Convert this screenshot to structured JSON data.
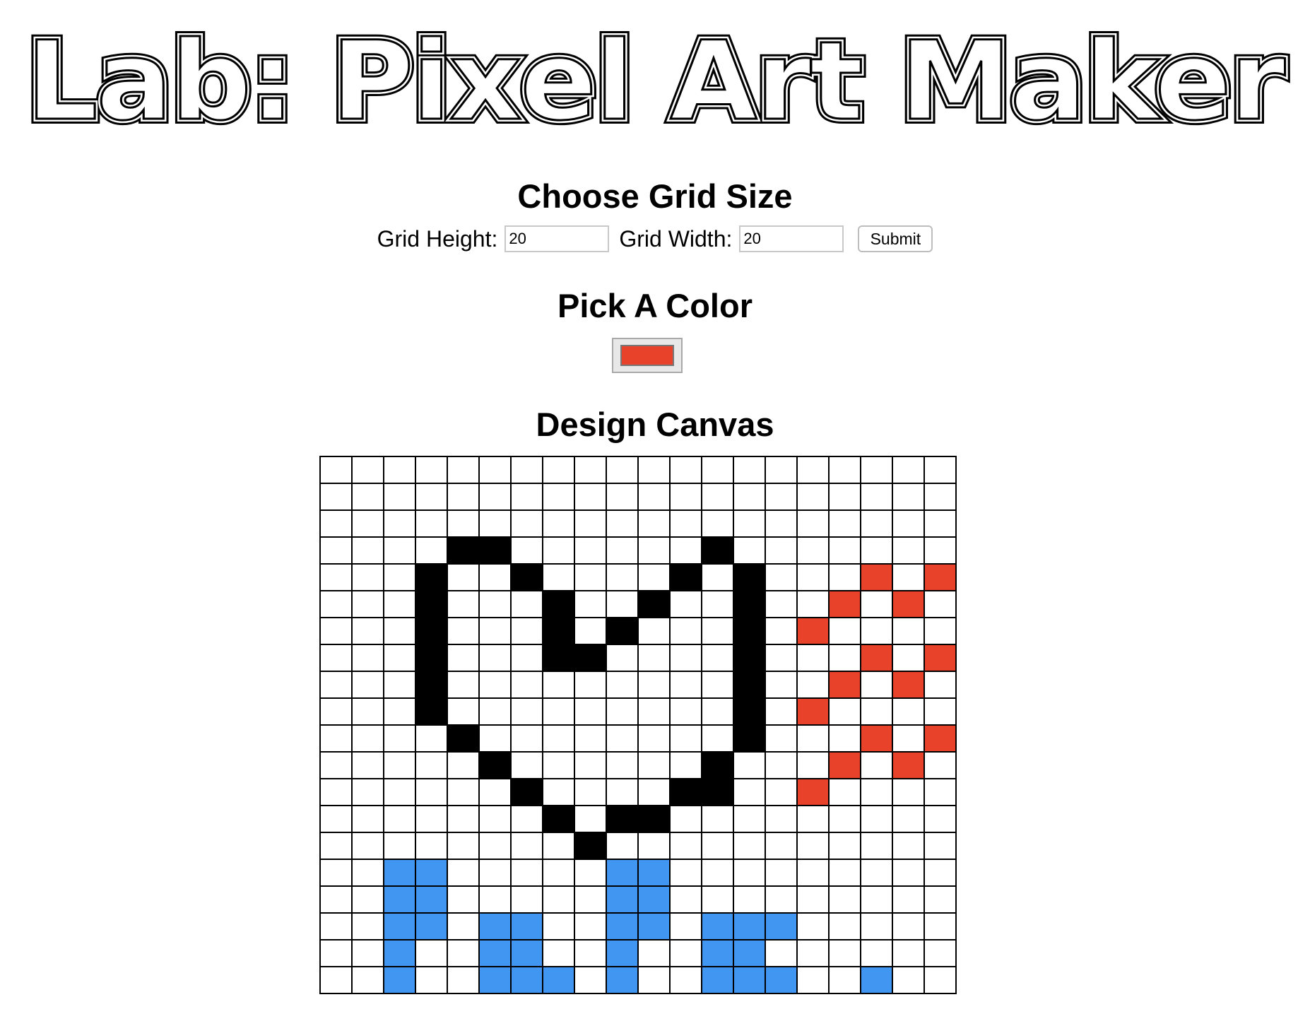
{
  "page": {
    "title": "Lab: Pixel Art Maker"
  },
  "size_section": {
    "heading": "Choose Grid Size",
    "height_label": "Grid Height:",
    "height_value": "20",
    "width_label": "Grid Width:",
    "width_value": "20",
    "submit_label": "Submit"
  },
  "color_section": {
    "heading": "Pick A Color",
    "selected_color": "#e8432a"
  },
  "canvas_section": {
    "heading": "Design Canvas",
    "rows": 20,
    "cols": 20,
    "palette": {
      "white": "#ffffff",
      "black": "#000000",
      "red": "#e8432a",
      "blue": "#4196f2"
    },
    "cells": [
      "....................",
      "....................",
      "....................",
      "....KK......K.......",
      "...K..K....K.K...R.R",
      "...K...K..K..K..R.R.",
      "...K...K.K...K.R....",
      "...K...KK....K...R.R",
      "...K.........K..R.R.",
      "...K.........K.R....",
      "....K........K...R.R",
      ".....K......K...R.R.",
      "......K....KK..R....",
      ".......K.KK.........",
      "........K...........",
      "..BB.....BB.........",
      "..BB.....BB.........",
      "..BB.BB..BB.BBB.....",
      "..B..BB..B..BB......",
      "..B..BBB.B..BBB..B.."
    ]
  }
}
